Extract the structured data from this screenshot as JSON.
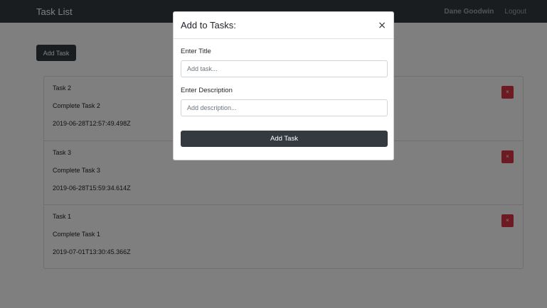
{
  "navbar": {
    "brand": "Task List",
    "user_name": "Dane Goodwin",
    "logout_label": "Logout"
  },
  "main": {
    "add_task_label": "Add Task",
    "tasks": [
      {
        "title": "Task 2",
        "description": "Complete Task 2",
        "date": "2019-06-28T12:57:49.498Z",
        "delete_label": "×"
      },
      {
        "title": "Task 3",
        "description": "Complete Task 3",
        "date": "2019-06-28T15:59:34.614Z",
        "delete_label": "×"
      },
      {
        "title": "Task 1",
        "description": "Complete Task 1",
        "date": "2019-07-01T13:30:45.366Z",
        "delete_label": "×"
      }
    ]
  },
  "modal": {
    "title": "Add to Tasks:",
    "close_label": "×",
    "title_label": "Enter Title",
    "title_placeholder": "Add task...",
    "title_value": "",
    "description_label": "Enter Description",
    "description_placeholder": "Add description...",
    "description_value": "",
    "submit_label": "Add Task"
  },
  "colors": {
    "navbar_bg": "#343a40",
    "danger": "#dc3545",
    "backdrop": "rgba(0,0,0,0.5)"
  }
}
